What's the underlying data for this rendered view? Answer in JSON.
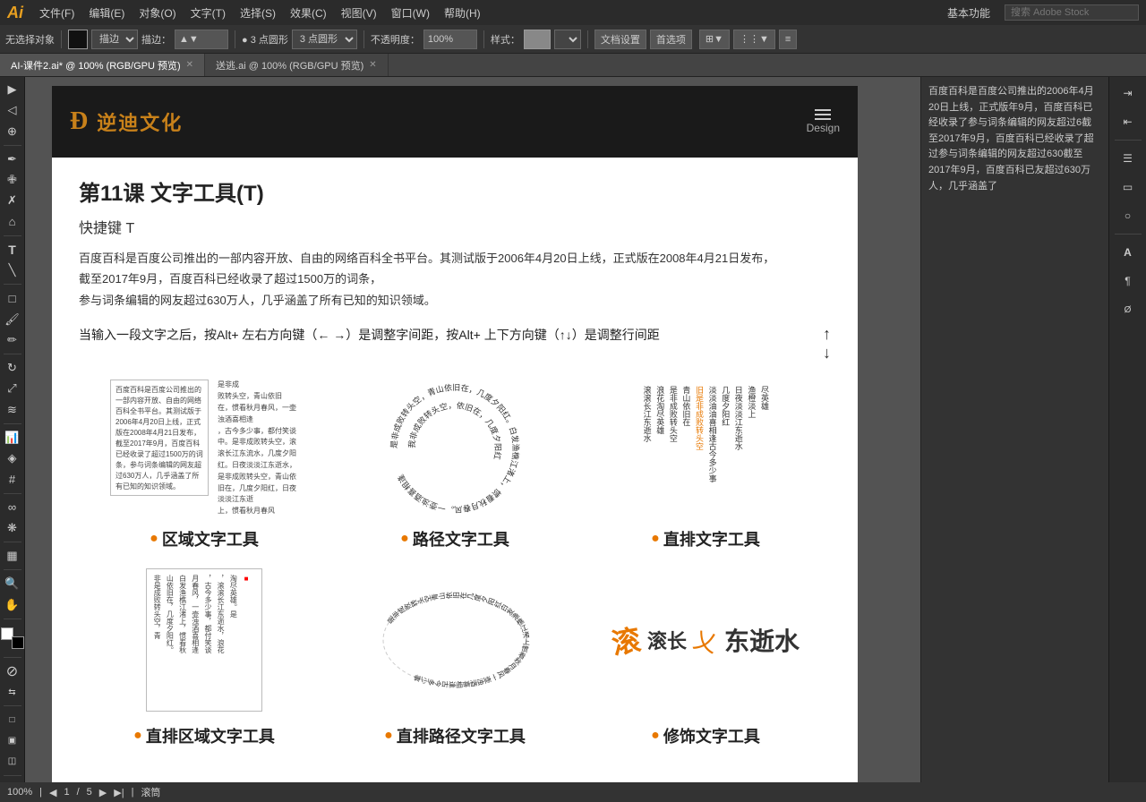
{
  "app": {
    "logo": "Ai",
    "logo_color": "#e8a020"
  },
  "menubar": {
    "items": [
      "文件(F)",
      "编辑(E)",
      "对象(O)",
      "文字(T)",
      "选择(S)",
      "效果(C)",
      "视图(V)",
      "窗口(W)",
      "帮助(H)"
    ],
    "right": "基本功能",
    "search_placeholder": "搜索 Adobe Stock"
  },
  "toolbar": {
    "no_select_label": "无选择对象",
    "spread_label": "描边：",
    "point_label": "● 3 点圆形",
    "opacity_label": "不透明度：",
    "opacity_value": "100%",
    "style_label": "样式：",
    "doc_settings": "文档设置",
    "preferences": "首选项"
  },
  "tabs": [
    {
      "label": "AI-课件2.ai* @ 100% (RGB/GPU 预览)",
      "active": true
    },
    {
      "label": "送逃.ai @ 100% (RGB/GPU 预览)",
      "active": false
    }
  ],
  "canvas": {
    "header": {
      "logo_icon": "D",
      "logo_text": "逆迪文化",
      "menu_label": "Design"
    },
    "lesson": {
      "title": "第11课   文字工具(T)",
      "shortcut": "快捷键 T",
      "description1": "百度百科是百度公司推出的一部内容开放、自由的网络百科全书平台。其测试版于2006年4月20日上线，正式版在2008年4月21日发布，",
      "description2": "截至2017年9月，百度百科已经收录了超过1500万的词条，",
      "description3": "参与词条编辑的网友超过630万人，几乎涵盖了所有已知的知识领域。",
      "note": "当输入一段文字之后，按Alt+ 左右方向键（← →）是调整字间距，按Alt+ 上下方向键（↑↓）是调整行间距"
    },
    "tools": [
      {
        "name": "区域文字工具",
        "desc_text": "百度百科是百度公司推出的一部内容开放、自由的网络百科全书平台。其测试版于2006年4月20日上线，正式版在2008年4月21日发布，截至2017年9月，百度百科已经收录了超过1500万的词条，参与词条编辑的网友超过630万人，几乎涵盖了所有已知的知识领域。"
      },
      {
        "name": "路径文字工具",
        "desc_text": "是非成败转头空，青山依旧在，几度夕阳红。白发渔樵江渚上，惯看秋月春风。"
      },
      {
        "name": "直排文字工具",
        "desc_text": "滚滚长江东逝水，浪花淘尽英雄。是非成败转头空，青山依旧在。"
      }
    ],
    "tools_bottom": [
      {
        "name": "直排区域文字工具"
      },
      {
        "name": "直排路径文字工具"
      },
      {
        "name": "修饰文字工具"
      }
    ]
  },
  "right_panel": {
    "text": "百度百科是百度公司推出的2006年4月20日上线，正式版年9月，百度百科已经收录了参与词条编辑的网友超过6截至2017年9月，百度百科已经收录了超过参与词条编辑的网友超过630截至2017年9月，百度百科已友超过630万人，几乎涵盖了"
  },
  "status_bar": {
    "zoom": "100%",
    "page_info": "1",
    "total_pages": "5",
    "position_label": "滚筒"
  },
  "icons": {
    "arrow": "▶",
    "move": "✛",
    "pen": "✒",
    "text": "T",
    "zoom": "🔍",
    "hand": "✋",
    "shape": "□",
    "gradient": "◈"
  }
}
